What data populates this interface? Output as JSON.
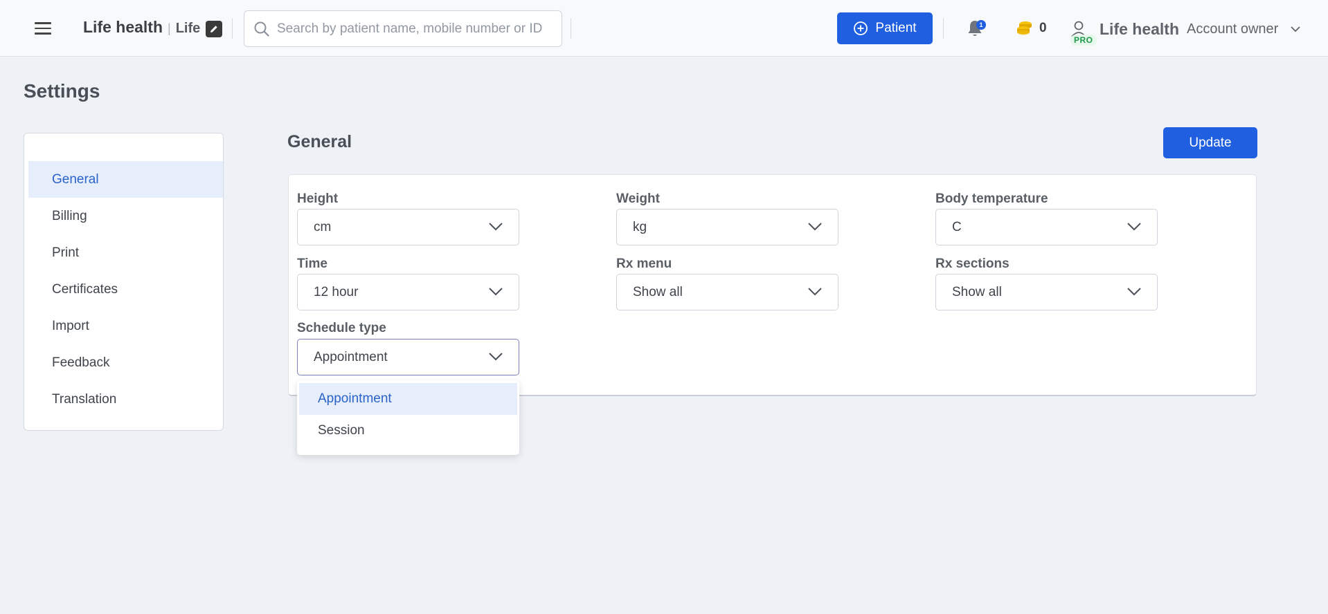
{
  "header": {
    "brand_name": "Life health",
    "brand_separator": "|",
    "brand_short": "Life",
    "search_placeholder": "Search by patient name, mobile number or ID",
    "patient_button": "Patient",
    "notification_count": "1",
    "coins_count": "0",
    "account_name": "Life health",
    "account_role": "Account owner",
    "pro_badge": "PRO"
  },
  "page": {
    "title": "Settings"
  },
  "sidebar": {
    "items": [
      {
        "label": "General",
        "active": true
      },
      {
        "label": "Billing"
      },
      {
        "label": "Print"
      },
      {
        "label": "Certificates"
      },
      {
        "label": "Import"
      },
      {
        "label": "Feedback"
      },
      {
        "label": "Translation"
      }
    ]
  },
  "main": {
    "section_title": "General",
    "update_button": "Update",
    "fields": {
      "height": {
        "label": "Height",
        "value": "cm"
      },
      "weight": {
        "label": "Weight",
        "value": "kg"
      },
      "body_temperature": {
        "label": "Body temperature",
        "value": "C"
      },
      "time": {
        "label": "Time",
        "value": "12 hour"
      },
      "rx_menu": {
        "label": "Rx menu",
        "value": "Show all"
      },
      "rx_sections": {
        "label": "Rx sections",
        "value": "Show all"
      },
      "schedule_type": {
        "label": "Schedule type",
        "value": "Appointment"
      }
    },
    "schedule_dropdown": {
      "options": [
        "Appointment",
        "Session"
      ],
      "selected": "Appointment"
    }
  },
  "colors": {
    "primary": "#1f5fe0",
    "active_bg": "#e6eefc",
    "active_text": "#2a62c9",
    "page_bg": "#eef1f6"
  }
}
